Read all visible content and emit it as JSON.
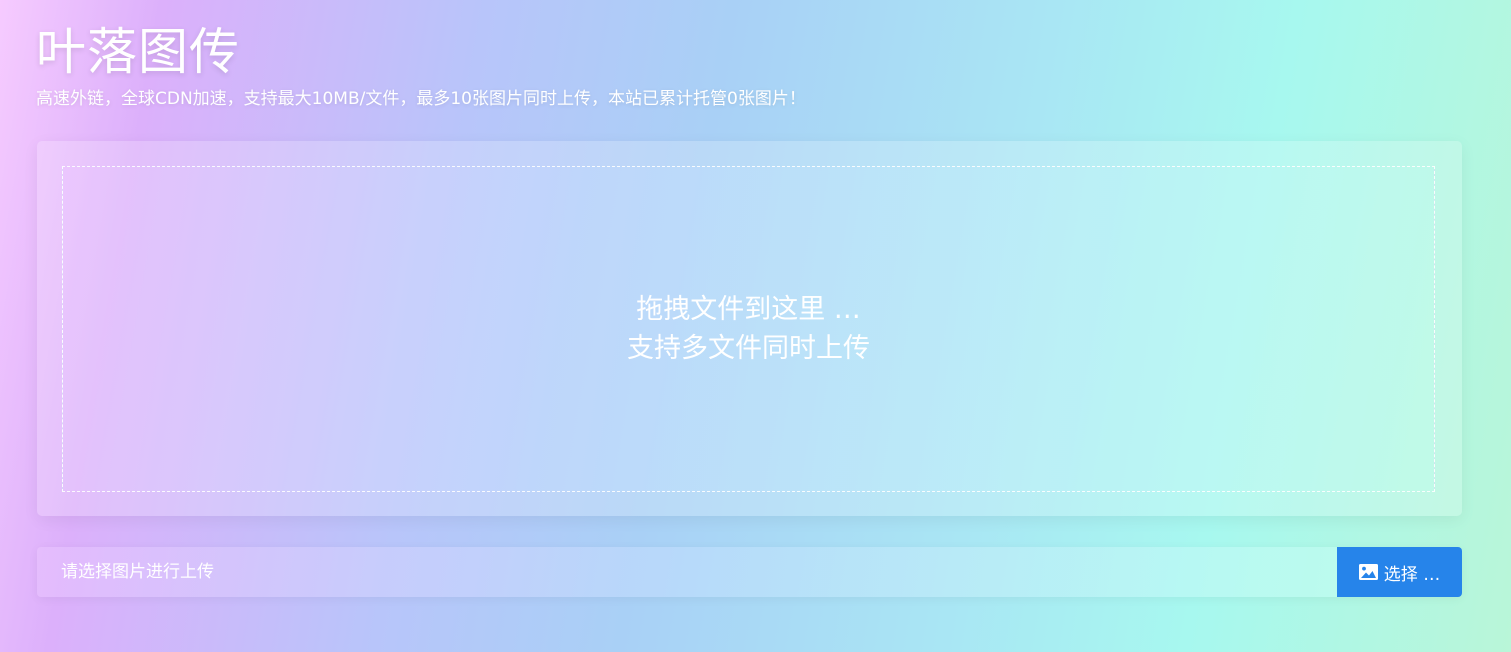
{
  "header": {
    "title": "叶落图传",
    "subtitle": "高速外链，全球CDN加速，支持最大10MB/文件，最多10张图片同时上传，本站已累计托管0张图片！"
  },
  "drop_zone": {
    "line1": "拖拽文件到这里 …",
    "line2": "支持多文件同时上传"
  },
  "upload_bar": {
    "placeholder": "请选择图片进行上传",
    "value": "",
    "choose_label": "选择 …",
    "choose_icon": "image-icon"
  },
  "colors": {
    "accent": "#2684ea",
    "text": "#ffffff"
  }
}
